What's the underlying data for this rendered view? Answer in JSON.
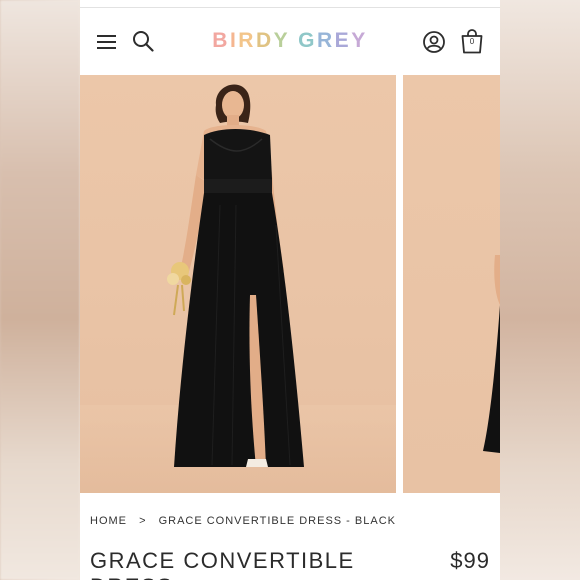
{
  "header": {
    "logo_letters": [
      "B",
      "I",
      "R",
      "D",
      "Y",
      " ",
      "G",
      "R",
      "E",
      "Y"
    ],
    "cart_count": "0",
    "icons": [
      "menu-icon",
      "search-icon",
      "account-icon",
      "bag-icon"
    ]
  },
  "breadcrumb": {
    "home": "HOME",
    "separator": ">",
    "current": "GRACE CONVERTIBLE DRESS - BLACK"
  },
  "product": {
    "title": "GRACE CONVERTIBLE DRESS",
    "price": "$99",
    "dress_color": "#111111",
    "backdrop_color": "#ecc7a9"
  }
}
